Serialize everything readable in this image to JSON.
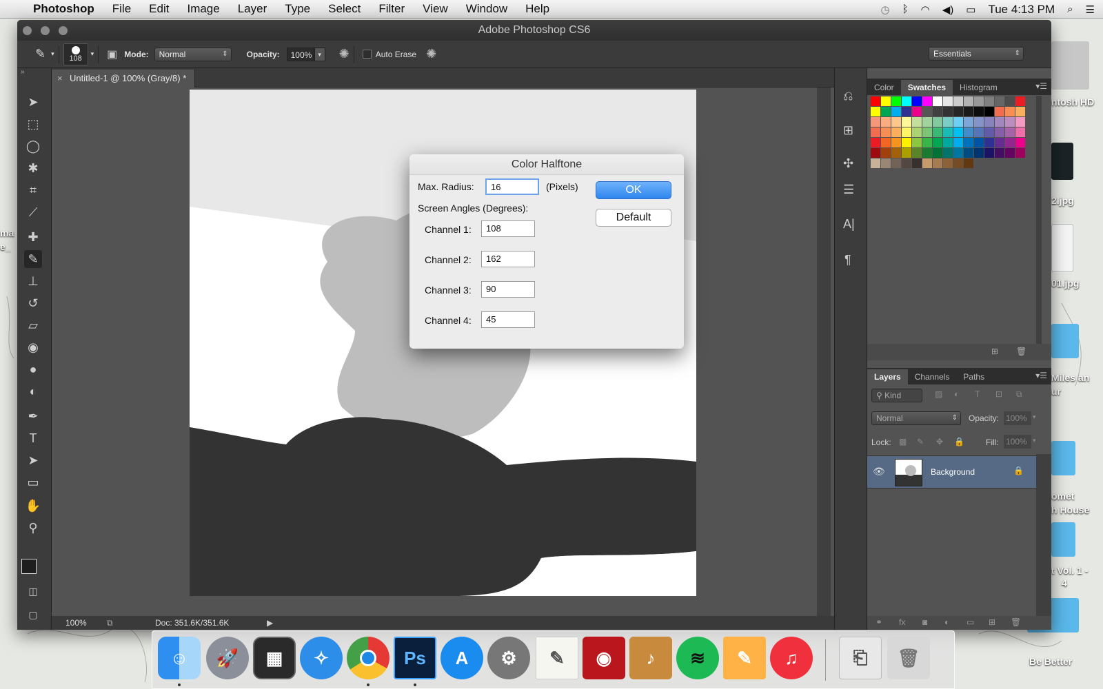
{
  "menubar": {
    "apple_icon": "apple-icon",
    "app_name": "Photoshop",
    "items": [
      "File",
      "Edit",
      "Image",
      "Layer",
      "Type",
      "Select",
      "Filter",
      "View",
      "Window",
      "Help"
    ],
    "clock": "Tue 4:13 PM"
  },
  "window": {
    "title": "Adobe Photoshop CS6"
  },
  "options_bar": {
    "brush_size": "108",
    "mode_label": "Mode:",
    "mode_value": "Normal",
    "opacity_label": "Opacity:",
    "opacity_value": "100%",
    "auto_erase_label": "Auto Erase",
    "workspace_value": "Essentials"
  },
  "document": {
    "tab_label": "Untitled-1 @ 100% (Gray/8) *",
    "zoom": "100%",
    "doc_info": "Doc: 351.6K/351.6K"
  },
  "swatches_panel": {
    "tabs": [
      "Color",
      "Swatches",
      "Histogram"
    ],
    "active_tab": "Swatches"
  },
  "layers_panel": {
    "tabs": [
      "Layers",
      "Channels",
      "Paths"
    ],
    "active_tab": "Layers",
    "filter_label": "Kind",
    "blend_mode": "Normal",
    "opacity_label": "Opacity:",
    "opacity_value": "100%",
    "lock_label": "Lock:",
    "fill_label": "Fill:",
    "fill_value": "100%",
    "layer_name": "Background"
  },
  "dialog": {
    "title": "Color Halftone",
    "max_radius_label": "Max. Radius:",
    "max_radius_value": "16",
    "pixels_label": "(Pixels)",
    "screen_angles_label": "Screen Angles (Degrees):",
    "channel1_label": "Channel 1:",
    "channel1_value": "108",
    "channel2_label": "Channel 2:",
    "channel2_value": "162",
    "channel3_label": "Channel 3:",
    "channel3_value": "90",
    "channel4_label": "Channel 4:",
    "channel4_value": "45",
    "ok_label": "OK",
    "default_label": "Default"
  },
  "desktop_icons": {
    "hd": "ntosh HD",
    "jpg1": "2.jpg",
    "jpg2": "01.jpg",
    "miles": "Miles an",
    "miles2": "ur",
    "comet": "omet",
    "house": "h House",
    "vol": "t Vol. 1 -",
    "vol2": "4",
    "better": "Be Better",
    "left1": "ma",
    "left2": "e_"
  },
  "colors": {
    "accent_blue": "#3b8ef0",
    "panel_dark": "#3c3c3c",
    "panel_mid": "#535353"
  }
}
